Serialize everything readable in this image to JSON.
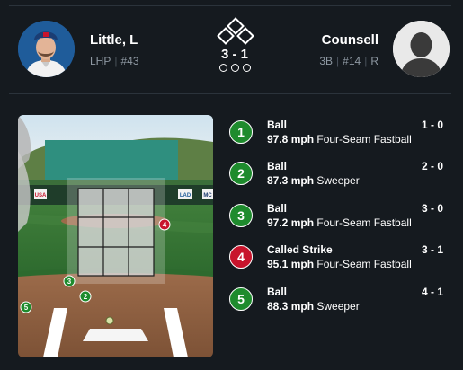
{
  "colors": {
    "background": "#151a1f",
    "ball": "#1e8b2d",
    "strike": "#c8142c",
    "muted": "#8f99a3"
  },
  "pitcher": {
    "name": "Little, L",
    "throws": "LHP",
    "number": "#43",
    "avatar_icon": "pitcher-headshot"
  },
  "batter": {
    "name": "Counsell",
    "position": "3B",
    "number": "#14",
    "bats": "R",
    "avatar_icon": "player-silhouette"
  },
  "situation": {
    "count": "3 - 1",
    "bases_occupied": [
      false,
      false,
      false
    ],
    "outs": 0
  },
  "field": {
    "ads": [
      "USA",
      "LAD",
      "MC"
    ]
  },
  "pitches": [
    {
      "number": "1",
      "result": "Ball",
      "count": "1 - 0",
      "speed": "97.8 mph",
      "type": "Four-Seam Fastball",
      "kind": "ball"
    },
    {
      "number": "2",
      "result": "Ball",
      "count": "2 - 0",
      "speed": "87.3 mph",
      "type": "Sweeper",
      "kind": "ball"
    },
    {
      "number": "3",
      "result": "Ball",
      "count": "3 - 0",
      "speed": "97.2 mph",
      "type": "Four-Seam Fastball",
      "kind": "ball"
    },
    {
      "number": "4",
      "result": "Called Strike",
      "count": "3 - 1",
      "speed": "95.1 mph",
      "type": "Four-Seam Fastball",
      "kind": "strike"
    },
    {
      "number": "5",
      "result": "Ball",
      "count": "4 - 1",
      "speed": "88.3 mph",
      "type": "Sweeper",
      "kind": "ball"
    }
  ]
}
